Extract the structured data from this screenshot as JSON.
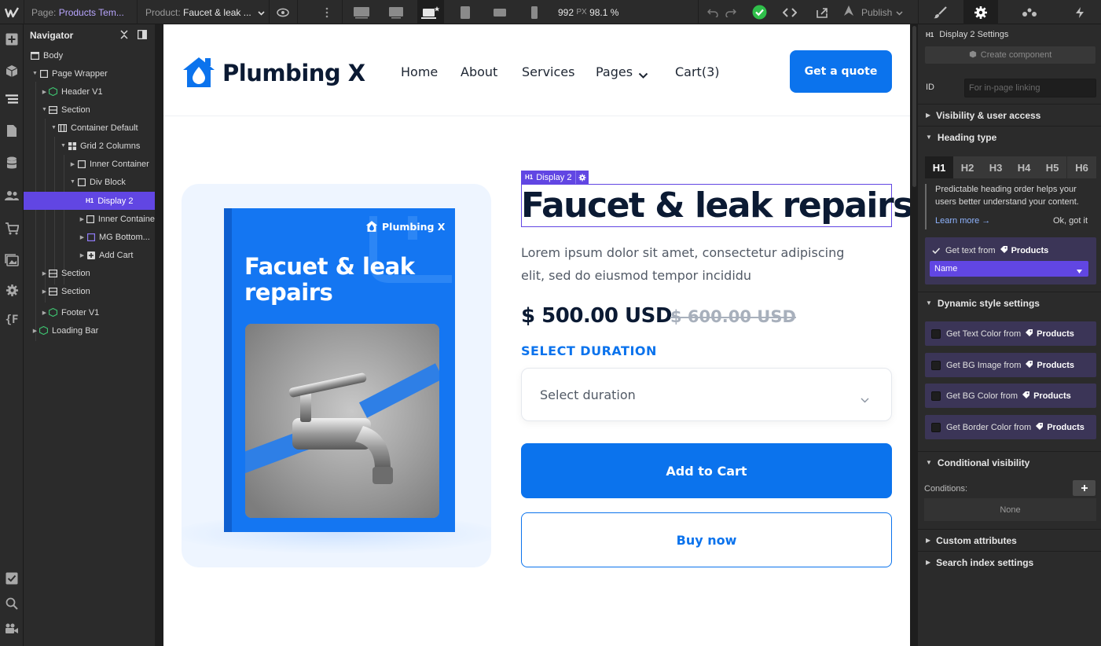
{
  "topbar": {
    "page_label": "Page:",
    "page_value": "Products Tem...",
    "product_label": "Product:",
    "product_value": "Faucet & leak ...",
    "width_value": "992",
    "width_unit": "PX",
    "zoom": "98.1 %",
    "publish_label": "Publish"
  },
  "navigator": {
    "title": "Navigator",
    "items": [
      {
        "label": "Body"
      },
      {
        "label": "Page Wrapper"
      },
      {
        "label": "Header V1"
      },
      {
        "label": "Section"
      },
      {
        "label": "Container Default"
      },
      {
        "label": "Grid 2 Columns"
      },
      {
        "label": "Inner Container"
      },
      {
        "label": "Div Block"
      },
      {
        "label": "Display 2",
        "tag": "H1"
      },
      {
        "label": "Inner Containe"
      },
      {
        "label": "MG Bottom..."
      },
      {
        "label": "Add Cart"
      },
      {
        "label": "Section"
      },
      {
        "label": "Section"
      },
      {
        "label": "Footer V1"
      },
      {
        "label": "Loading Bar"
      }
    ]
  },
  "site": {
    "brand": "Plumbing X",
    "nav": [
      "Home",
      "About",
      "Services",
      "Pages",
      "Cart(3)"
    ],
    "cta": "Get a quote",
    "book_brand": "Plumbing X",
    "book_title_line1": "Facuet & leak",
    "book_title_line2": "repairs",
    "selected_badge_tag": "H1",
    "selected_badge_name": "Display 2",
    "product_title": "Faucet & leak repairs",
    "description": "Lorem ipsum dolor sit amet, consectetur adipiscing elit, sed do eiusmod tempor incididu",
    "price": "$ 500.00 USD",
    "old_price": "$ 600.00 USD",
    "duration_label": "SELECT DURATION",
    "duration_placeholder": "Select duration",
    "add_to_cart": "Add to Cart",
    "buy_now": "Buy now"
  },
  "panel": {
    "element_tag": "H1",
    "element_title": "Display 2 Settings",
    "create_component": "Create component",
    "id_label": "ID",
    "id_placeholder": "For in-page linking",
    "visibility": "Visibility & user access",
    "heading_type": "Heading type",
    "headings": [
      "H1",
      "H2",
      "H3",
      "H4",
      "H5",
      "H6"
    ],
    "tip_text": "Predictable heading order helps your users better understand your content.",
    "learn_more": "Learn more →",
    "ok_got_it": "Ok, got it",
    "get_text_from": "Get text from",
    "products": "Products",
    "field_value": "Name",
    "dynamic_style": "Dynamic style settings",
    "dyn_items": [
      "Get Text Color from",
      "Get BG Image from",
      "Get BG Color from",
      "Get Border Color from"
    ],
    "conditional_visibility": "Conditional visibility",
    "conditions_label": "Conditions:",
    "conditions_value": "None",
    "custom_attributes": "Custom attributes",
    "search_index": "Search index settings"
  },
  "colors": {
    "accent": "#6146e3",
    "brand_blue": "#0b73ed",
    "publish_ok": "#2fbf4a"
  }
}
